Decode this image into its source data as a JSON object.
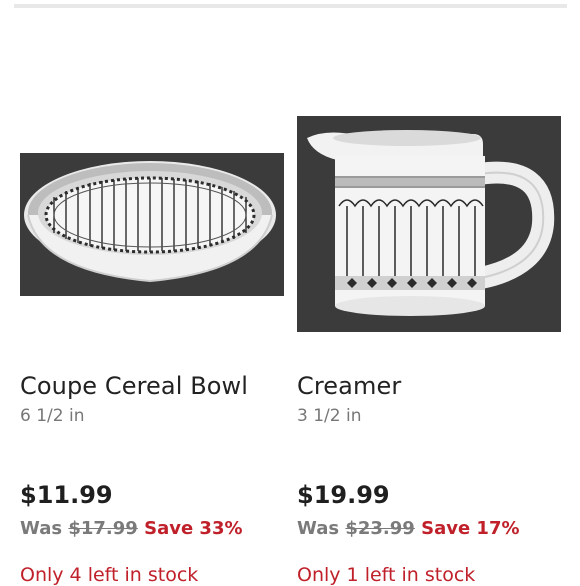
{
  "products": [
    {
      "title": "Coupe Cereal Bowl",
      "size": "6 1/2 in",
      "price": "$11.99",
      "was_label": "Was",
      "was_price": "$17.99",
      "save": "Save 33%",
      "stock": "Only 4 left in stock"
    },
    {
      "title": "Creamer",
      "size": "3 1/2 in",
      "price": "$19.99",
      "was_label": "Was",
      "was_price": "$23.99",
      "save": "Save 17%",
      "stock": "Only 1 left in stock"
    }
  ],
  "colors": {
    "sale_red": "#c0202a",
    "muted_gray": "#7a7a7a",
    "photo_background": "#3a3a3a"
  }
}
